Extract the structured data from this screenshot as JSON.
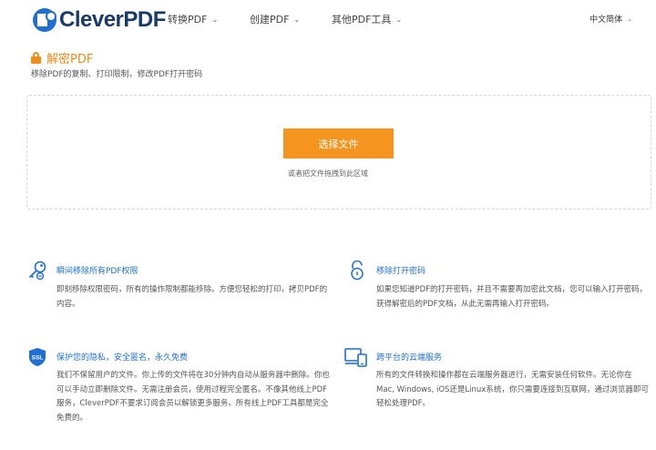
{
  "brand": {
    "name": "CleverPDF"
  },
  "nav": {
    "items": [
      {
        "label": "转换PDF"
      },
      {
        "label": "创建PDF"
      },
      {
        "label": "其他PDF工具"
      }
    ],
    "language": "中文简体"
  },
  "page": {
    "title": "解密PDF",
    "subtitle": "移除PDF的复制、打印限制，修改PDF打开密码"
  },
  "upload": {
    "button_label": "选择文件",
    "hint": "或者把文件拖拽到此区域"
  },
  "features": [
    {
      "icon": "key-icon",
      "title": "瞬间移除所有PDF权限",
      "description": "即刻移除权限密码，所有的操作限制都能移除。方便您轻松的打印，拷贝PDF的内容。"
    },
    {
      "icon": "unlock-icon",
      "title": "移除打开密码",
      "description": "如果您知道PDF的打开密码，并且不需要再加密此文档，您可以输入打开密码，获得解密后的PDF文档，从此无需再输入打开密码。"
    },
    {
      "icon": "ssl-shield-icon",
      "title": "保护您的隐私，安全匿名，永久免费",
      "description": "我们不保留用户的文件。你上传的文件将在30分钟内自动从服务器中删除。你也可以手动立即删除文件。无需注册会员，使用过程完全匿名。不像其他线上PDF服务，CleverPDF不要求订阅会员以解锁更多服务。所有线上PDF工具都是完全免费的。"
    },
    {
      "icon": "devices-icon",
      "title": "跨平台的云端服务",
      "description": "所有的文件转换和操作都在云端服务器进行，无需安装任何软件。无论你在Mac, Windows, iOS还是Linux系统，你只需要连接到互联网，通过浏览器即可轻松处理PDF。"
    }
  ],
  "colors": {
    "accent_orange": "#f5941e",
    "title_orange": "#f08c19",
    "link_blue": "#1f6fd0",
    "brand_navy": "#1a3a6b"
  }
}
